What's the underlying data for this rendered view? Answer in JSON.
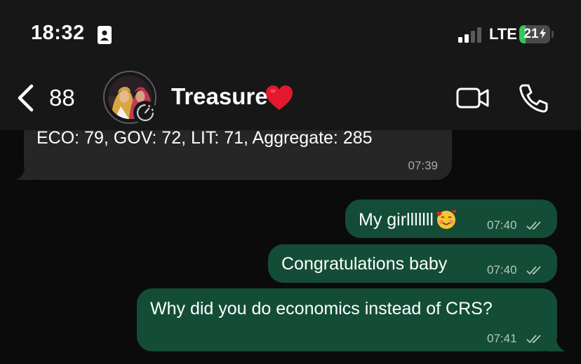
{
  "status_bar": {
    "time": "18:32",
    "network": "LTE",
    "battery_level": "21",
    "battery_fraction": 0.21,
    "icons": [
      "id-card-icon",
      "signal-icon",
      "charging-bolt-icon"
    ]
  },
  "header": {
    "back_count": "88",
    "contact_name": "Treasure",
    "name_emoji": "heart-icon",
    "icons": [
      "back-chevron-icon",
      "disappearing-timer-icon",
      "video-call-icon",
      "voice-call-icon"
    ]
  },
  "messages": [
    {
      "direction": "incoming",
      "text": "ECO: 79, GOV: 72, LIT: 71, Aggregate: 285",
      "time": "07:39"
    },
    {
      "direction": "outgoing",
      "text": "My girlllllll",
      "emoji": "smiling-face-with-hearts",
      "time": "07:40",
      "status": "read"
    },
    {
      "direction": "outgoing",
      "text": "Congratulations baby",
      "time": "07:40",
      "status": "read"
    },
    {
      "direction": "outgoing",
      "text": "Why did you do economics instead of CRS?",
      "time": "07:41",
      "status": "read"
    }
  ],
  "colors": {
    "background": "#0b0b0b",
    "header": "#171717",
    "incoming_bubble": "#262626",
    "outgoing_bubble": "#144d37",
    "battery": "#34c759",
    "heart": "#e3182d"
  }
}
